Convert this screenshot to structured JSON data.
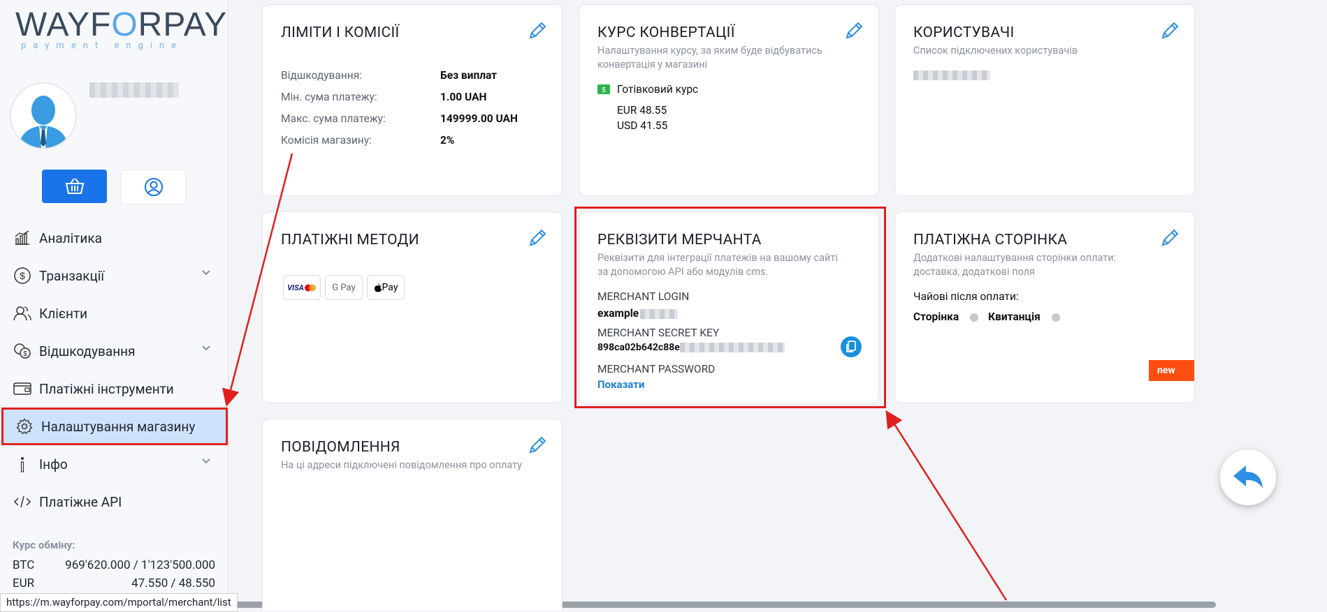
{
  "logo": {
    "part1": "WAY",
    "part2": "F",
    "part3": "R",
    "part4": "PAY",
    "sub": "payment engine"
  },
  "sidebar": {
    "items": [
      {
        "label": "Аналітика",
        "icon": "analytics-icon",
        "chevron": false
      },
      {
        "label": "Транзакції",
        "icon": "dollar-circle-icon",
        "chevron": true
      },
      {
        "label": "Клієнти",
        "icon": "users-icon",
        "chevron": false
      },
      {
        "label": "Відшкодування",
        "icon": "coins-icon",
        "chevron": true
      },
      {
        "label": "Платіжні інструменти",
        "icon": "wallet-icon",
        "chevron": false
      },
      {
        "label": "Налаштування магазину",
        "icon": "gear-icon",
        "chevron": false,
        "active": true
      },
      {
        "label": "Інфо",
        "icon": "info-icon",
        "chevron": true
      },
      {
        "label": "Платіжне API",
        "icon": "code-icon",
        "chevron": false
      }
    ],
    "rates_title": "Курс обміну:",
    "rates": [
      {
        "code": "BTC",
        "value": "969'620.000 / 1'123'500.000"
      },
      {
        "code": "EUR",
        "value": "47.550 / 48.550"
      }
    ]
  },
  "status_url": "https://m.wayforpay.com/mportal/merchant/list",
  "cards": {
    "limits": {
      "title": "ЛІМІТИ І КОМІСІЇ",
      "rows": [
        {
          "key": "Відшкодування:",
          "value": "Без виплат"
        },
        {
          "key": "Мін. сума платежу:",
          "value": "1.00 UAH"
        },
        {
          "key": "Макс. сума платежу:",
          "value": "149999.00 UAH"
        },
        {
          "key": "Комісія магазину:",
          "value": "2%"
        }
      ]
    },
    "conversion": {
      "title": "КУРС КОНВЕРТАЦІЇ",
      "desc_line1": "Налаштування курсу, за яким буде відбуватись",
      "desc_line2": "конвертація у магазині",
      "cash_label": "Готівковий курс",
      "rates": [
        "EUR 48.55",
        "USD 41.55"
      ]
    },
    "users": {
      "title": "КОРИСТУВАЧІ",
      "desc": "Список підключених користувачів"
    },
    "methods": {
      "title": "ПЛАТІЖНІ МЕТОДИ",
      "badges": [
        "VISA",
        "G Pay",
        "Pay"
      ]
    },
    "merchant": {
      "title": "РЕКВІЗИТИ МЕРЧАНТА",
      "desc_line1": "Реквізити для інтеграції платежів на вашому сайті",
      "desc_line2": "за допомогою API або модулів cms.",
      "login_label": "MERCHANT LOGIN",
      "login_value": "example",
      "secret_label": "MERCHANT SECRET KEY",
      "secret_value": "898ca02b642c88e",
      "password_label": "MERCHANT PASSWORD",
      "show_link": "Показати"
    },
    "payment_page": {
      "title": "ПЛАТІЖНА СТОРІНКА",
      "desc_line1": "Додаткові налаштування сторінки оплати:",
      "desc_line2": "доставка, додаткові поля",
      "tips_label": "Чайові після оплати:",
      "option1": "Сторінка",
      "option2": "Квитанція",
      "badge": "new"
    },
    "notifications": {
      "title": "ПОВІДОМЛЕННЯ",
      "desc": "На ці адреси підключені повідомлення про оплату"
    }
  },
  "colors": {
    "accent": "#1a73e8",
    "annotation_red": "#e0201e",
    "badge_orange": "#ff4d12"
  }
}
